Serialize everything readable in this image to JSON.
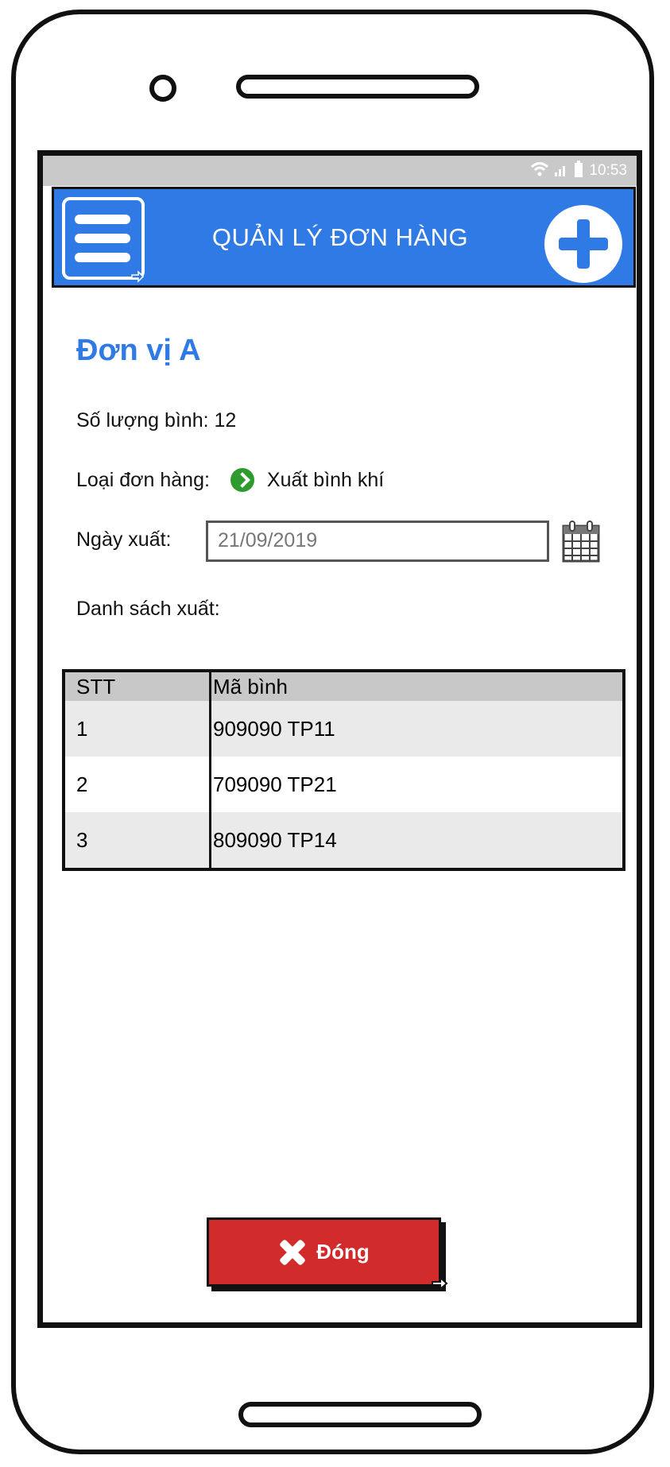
{
  "statusbar": {
    "time": "10:53",
    "icons": [
      "wifi-icon",
      "signal-icon",
      "battery-icon"
    ]
  },
  "header": {
    "title": "QUẢN LÝ ĐƠN HÀNG",
    "menu_icon": "menu-icon",
    "add_icon": "plus-icon",
    "color": "#2f7ae5"
  },
  "main": {
    "unit_name": "Đơn vị A",
    "quantity_text": "Số lượng bình: 12",
    "order_type_label": "Loại đơn hàng:",
    "order_type_value": "Xuất bình khí",
    "export_date_label": "Ngày xuất:",
    "export_date_value": "21/09/2019",
    "list_label": "Danh sách xuất:"
  },
  "table": {
    "headers": [
      "STT",
      "Mã bình"
    ],
    "rows": [
      [
        "1",
        "909090 TP11"
      ],
      [
        "2",
        "709090 TP21"
      ],
      [
        "3",
        "809090 TP14"
      ]
    ]
  },
  "footer": {
    "close_label": "Đóng",
    "close_icon": "close-icon",
    "button_color": "#d22b2b"
  }
}
